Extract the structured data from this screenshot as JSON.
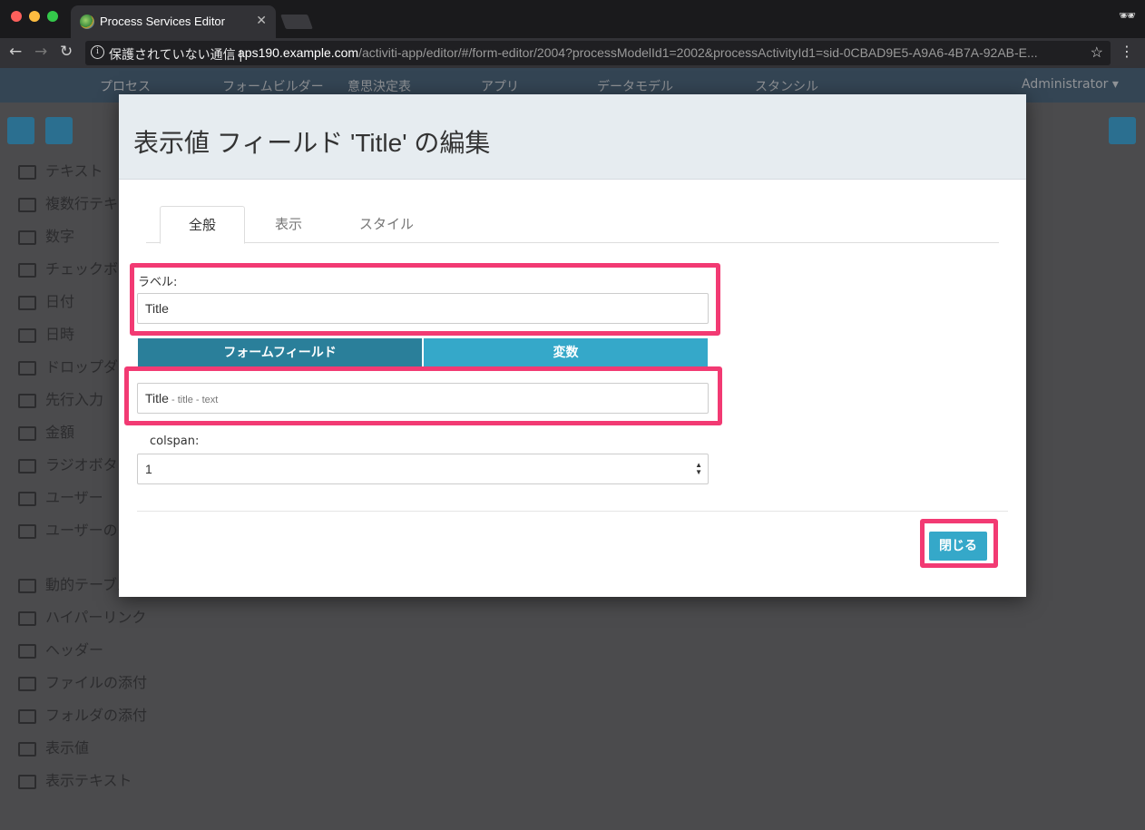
{
  "browser": {
    "tab_title": "Process Services Editor",
    "tab_close": "✕",
    "back": "←",
    "forward": "→",
    "reload": "↻",
    "security_text": "保護されていない通信",
    "url_host": "aps190.example.com",
    "url_path": "/activiti-app/editor/#/form-editor/2004?processModelId1=2002&processActivityId1=sid-0CBAD9E5-A9A6-4B7A-92AB-E...",
    "star": "☆",
    "menu": "⋮"
  },
  "background_app": {
    "nav": [
      "プロセス",
      "フォームビルダー",
      "意思決定表",
      "アプリ",
      "データモデル",
      "スタンシル"
    ],
    "user": "Administrator ▾",
    "palette": [
      "テキスト",
      "複数行テキスト",
      "数字",
      "チェックボックス",
      "日付",
      "日時",
      "ドロップダウン",
      "先行入力",
      "金額",
      "ラジオボタン",
      "ユーザー",
      "ユーザーのグループ",
      "動的テーブル",
      "ハイパーリンク",
      "ヘッダー",
      "ファイルの添付",
      "フォルダの添付",
      "表示値",
      "表示テキスト"
    ]
  },
  "dialog": {
    "title": "表示値 フィールド 'Title' の編集",
    "tabs": [
      "全般",
      "表示",
      "スタイル"
    ],
    "label_caption": "ラベル:",
    "label_value": "Title",
    "segment_form_field": "フォームフィールド",
    "segment_variable": "変数",
    "field_name": "Title",
    "field_meta": " - title - text",
    "colspan_caption": "colspan:",
    "colspan_value": "1",
    "close_button": "閉じる"
  },
  "colors": {
    "highlight": "#f23a73",
    "segment_active": "#2a7f9a",
    "segment_inactive": "#35a8c9",
    "primary_button": "#35a8c9"
  }
}
